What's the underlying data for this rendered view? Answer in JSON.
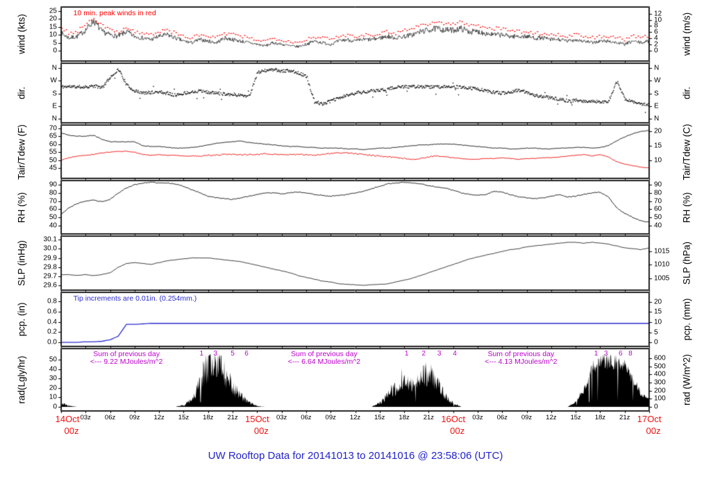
{
  "figure": {
    "title": "UW Rooftop Data for 20141013  to  20141016 @ 23:58:06  (UTC)"
  },
  "colors": {
    "line_black": "#000000",
    "peak_red": "#ff0000",
    "dew_red": "#ee1111",
    "annotation_red": "#ff0000",
    "pcp_blue": "#2a2acc",
    "title_blue": "#2222cc",
    "rad_magenta": "#bb00cc",
    "date_red": "#f01010",
    "axis": "#000000"
  },
  "x_axis": {
    "hours_span": 72,
    "minor_tick_hours": 3,
    "minor_labels": [
      "03z",
      "06z",
      "09z",
      "12z",
      "15z",
      "18z",
      "21z"
    ],
    "major_labels": [
      {
        "day": "14Oct",
        "hour": "00z",
        "t": 0
      },
      {
        "day": "15Oct",
        "hour": "00z",
        "t": 24
      },
      {
        "day": "16Oct",
        "hour": "00z",
        "t": 48
      },
      {
        "day": "17Oct",
        "hour": "00z",
        "t": 72
      }
    ]
  },
  "panels": [
    {
      "id": "wind",
      "label_left": "wind (kts)",
      "label_right": "wind (m/s)",
      "ylim": [
        -6.6,
        27.6
      ],
      "ticks_left": [
        {
          "v": 0,
          "label": "0"
        },
        {
          "v": 5,
          "label": "5"
        },
        {
          "v": 10,
          "label": "10"
        },
        {
          "v": 15,
          "label": "15"
        },
        {
          "v": 20,
          "label": "20"
        },
        {
          "v": 25,
          "label": "25"
        }
      ],
      "ticks_right": [
        {
          "v": 0,
          "label": "0"
        },
        {
          "v": 3.89,
          "label": "2"
        },
        {
          "v": 7.78,
          "label": "4"
        },
        {
          "v": 11.66,
          "label": "6"
        },
        {
          "v": 15.55,
          "label": "8"
        },
        {
          "v": 19.44,
          "label": "10"
        },
        {
          "v": 23.33,
          "label": "12"
        }
      ],
      "annotation": {
        "text": "10 min. peak winds in red",
        "t": 1.5,
        "color_key": "annotation_red"
      }
    },
    {
      "id": "dir",
      "label_left": "dir.",
      "label_right": "dir.",
      "ylim": [
        -29,
        394
      ],
      "ticks_left": [
        {
          "v": 0,
          "label": "N"
        },
        {
          "v": 90,
          "label": "E"
        },
        {
          "v": 180,
          "label": "S"
        },
        {
          "v": 270,
          "label": "W"
        },
        {
          "v": 360,
          "label": "N"
        }
      ],
      "ticks_right": [
        {
          "v": 0,
          "label": "N"
        },
        {
          "v": 90,
          "label": "E"
        },
        {
          "v": 180,
          "label": "S"
        },
        {
          "v": 270,
          "label": "W"
        },
        {
          "v": 360,
          "label": "N"
        }
      ]
    },
    {
      "id": "tair",
      "label_left": "Tair/Tdew (F)",
      "label_right": "Tair/Tdew (C)",
      "ylim": [
        38.5,
        72
      ],
      "ticks_left": [
        {
          "v": 45,
          "label": "45"
        },
        {
          "v": 50,
          "label": "50"
        },
        {
          "v": 55,
          "label": "55"
        },
        {
          "v": 60,
          "label": "60"
        },
        {
          "v": 65,
          "label": "65"
        },
        {
          "v": 70,
          "label": "70"
        }
      ],
      "ticks_right": [
        {
          "v": 50,
          "label": "10"
        },
        {
          "v": 59,
          "label": "15"
        },
        {
          "v": 68,
          "label": "20"
        }
      ]
    },
    {
      "id": "rh",
      "label_left": "RH (%)",
      "label_right": "RH (%)",
      "ylim": [
        29.8,
        95.1
      ],
      "ticks_left": [
        {
          "v": 40,
          "label": "40"
        },
        {
          "v": 50,
          "label": "50"
        },
        {
          "v": 60,
          "label": "60"
        },
        {
          "v": 70,
          "label": "70"
        },
        {
          "v": 80,
          "label": "80"
        },
        {
          "v": 90,
          "label": "90"
        }
      ],
      "ticks_right": [
        {
          "v": 40,
          "label": "40"
        },
        {
          "v": 50,
          "label": "50"
        },
        {
          "v": 60,
          "label": "60"
        },
        {
          "v": 70,
          "label": "70"
        },
        {
          "v": 80,
          "label": "80"
        },
        {
          "v": 90,
          "label": "90"
        }
      ]
    },
    {
      "id": "slp",
      "label_left": "SLP (inHg)",
      "label_right": "SLP (hPa)",
      "ylim": [
        29.551,
        30.137
      ],
      "ticks_left": [
        {
          "v": 29.6,
          "label": "29.6"
        },
        {
          "v": 29.7,
          "label": "29.7"
        },
        {
          "v": 29.8,
          "label": "29.8"
        },
        {
          "v": 29.9,
          "label": "29.9"
        },
        {
          "v": 30.0,
          "label": "30.0"
        },
        {
          "v": 30.1,
          "label": "30.1"
        }
      ],
      "ticks_right": [
        {
          "v": 29.678,
          "label": "1005"
        },
        {
          "v": 29.826,
          "label": "1010"
        },
        {
          "v": 29.973,
          "label": "1015"
        }
      ]
    },
    {
      "id": "pcp",
      "label_left": "pcp. (in)",
      "label_right": "pcp. (mm)",
      "ylim": [
        -0.081,
        0.977
      ],
      "ticks_left": [
        {
          "v": 0,
          "label": "0.0"
        },
        {
          "v": 0.2,
          "label": "0.2"
        },
        {
          "v": 0.4,
          "label": "0.4"
        },
        {
          "v": 0.6,
          "label": "0.6"
        },
        {
          "v": 0.8,
          "label": "0.8"
        }
      ],
      "ticks_right": [
        {
          "v": 0,
          "label": "0"
        },
        {
          "v": 0.197,
          "label": "5"
        },
        {
          "v": 0.394,
          "label": "10"
        },
        {
          "v": 0.591,
          "label": "15"
        },
        {
          "v": 0.787,
          "label": "20"
        }
      ],
      "annotation": {
        "text": "Tip increments are 0.01in. (0.254mm.)",
        "t": 1.5,
        "color_key": "pcp_blue"
      }
    },
    {
      "id": "rad",
      "label_left": "rad(Lgly/hr)",
      "label_right": "rad (W/m^2)",
      "ylim": [
        -4.4,
        61.8
      ],
      "ticks_left": [
        {
          "v": 0,
          "label": "0"
        },
        {
          "v": 10,
          "label": "10"
        },
        {
          "v": 20,
          "label": "20"
        },
        {
          "v": 30,
          "label": "30"
        },
        {
          "v": 40,
          "label": "40"
        },
        {
          "v": 50,
          "label": "50"
        }
      ],
      "ticks_right": [
        {
          "v": 0,
          "label": "0"
        },
        {
          "v": 8.6,
          "label": "100"
        },
        {
          "v": 17.2,
          "label": "200"
        },
        {
          "v": 25.8,
          "label": "300"
        },
        {
          "v": 34.4,
          "label": "400"
        },
        {
          "v": 43.0,
          "label": "500"
        },
        {
          "v": 51.6,
          "label": "600"
        }
      ],
      "sum_annotations": [
        {
          "line1": "Sum of previous day",
          "line2": "<--- 9.22 MJoules/m^2",
          "t": 8
        },
        {
          "line1": "Sum of previous day",
          "line2": "<--- 6.64 MJoules/m^2",
          "t": 32.2
        },
        {
          "line1": "Sum of previous day",
          "line2": "<--- 4.13 MJoules/m^2",
          "t": 56.3
        }
      ],
      "digit_groups": [
        {
          "items": [
            {
              "label": "1",
              "t": 17.2
            },
            {
              "label": "3",
              "t": 18.9
            },
            {
              "label": "5",
              "t": 21.0
            },
            {
              "label": "6",
              "t": 22.7
            }
          ]
        },
        {
          "items": [
            {
              "label": "1",
              "t": 42.3
            },
            {
              "label": "2",
              "t": 44.4
            },
            {
              "label": "3",
              "t": 46.3
            },
            {
              "label": "4",
              "t": 48.2
            }
          ]
        },
        {
          "items": [
            {
              "label": "1",
              "t": 65.5
            },
            {
              "label": "3",
              "t": 66.7
            },
            {
              "label": "6",
              "t": 68.5
            },
            {
              "label": "8",
              "t": 69.7
            }
          ]
        }
      ]
    }
  ],
  "chart_data": {
    "type": "line",
    "x_unit": "hours since 14Oct 00z (UTC), hourly samples t=0..72",
    "x_range": [
      0,
      72
    ],
    "wind_avg_kts": [
      11,
      8,
      9,
      13,
      19,
      12,
      10,
      9,
      12,
      9,
      8,
      7,
      9,
      10,
      8,
      6,
      5,
      7,
      6,
      5,
      8,
      7,
      6,
      5,
      4,
      3,
      5,
      4,
      3,
      2.5,
      4,
      6,
      5,
      4,
      6,
      7,
      6,
      7,
      7,
      8,
      9,
      8,
      9,
      10,
      12,
      13,
      14,
      13,
      13,
      14,
      12,
      12,
      11,
      10,
      10,
      9,
      9,
      9,
      8,
      8,
      7,
      7,
      6,
      7,
      6,
      5,
      6,
      6,
      5,
      4,
      6,
      5,
      6
    ],
    "wind_peak_kts": [
      15,
      11,
      12,
      17,
      21,
      16,
      13,
      12,
      15,
      12,
      11,
      10,
      12,
      13,
      11,
      9,
      8,
      10,
      9,
      8,
      11,
      10,
      9,
      8,
      7,
      6,
      8,
      7,
      6,
      5,
      7,
      9,
      8,
      7,
      9,
      10,
      9,
      10,
      10,
      11,
      12,
      11,
      13,
      14,
      16,
      17,
      18,
      17,
      17,
      18,
      16,
      16,
      15,
      14,
      14,
      13,
      12,
      12,
      11,
      11,
      10,
      10,
      9,
      10,
      9,
      8,
      9,
      9,
      8,
      7,
      9,
      8,
      9
    ],
    "dir_deg": [
      230,
      232,
      228,
      230,
      235,
      225,
      300,
      355,
      240,
      200,
      185,
      190,
      195,
      185,
      170,
      185,
      195,
      200,
      190,
      185,
      180,
      175,
      170,
      165,
      330,
      345,
      350,
      340,
      345,
      330,
      300,
      120,
      110,
      130,
      150,
      170,
      185,
      195,
      200,
      205,
      215,
      225,
      230,
      232,
      230,
      228,
      230,
      232,
      230,
      225,
      220,
      215,
      200,
      190,
      185,
      195,
      205,
      190,
      170,
      160,
      150,
      140,
      130,
      135,
      125,
      130,
      120,
      130,
      270,
      140,
      120,
      110,
      100
    ],
    "tair_f": [
      67,
      65.5,
      65,
      65,
      65.5,
      63,
      61.5,
      61.5,
      61.5,
      61.5,
      59,
      58.5,
      58.5,
      58,
      57.5,
      57.5,
      58,
      58.5,
      59.5,
      60.5,
      61,
      61.5,
      62,
      61,
      60.5,
      60,
      59.5,
      59,
      58.5,
      58.5,
      58,
      58,
      57.5,
      57.5,
      57.5,
      57,
      57,
      56.5,
      57,
      57.5,
      57.5,
      58,
      58.5,
      59,
      59.5,
      59.5,
      60,
      60,
      60,
      59.5,
      59,
      58.5,
      58,
      57.5,
      57.5,
      57,
      57,
      57.5,
      57.5,
      57,
      57,
      57.5,
      57.5,
      58,
      58,
      57.5,
      58,
      59,
      62,
      64.5,
      66.5,
      68,
      68.5
    ],
    "tdew_f": [
      50,
      51.5,
      52.5,
      53,
      53.5,
      54.5,
      55,
      55.5,
      55.5,
      55,
      53.5,
      53,
      53.5,
      53,
      53,
      52.5,
      52.5,
      52.5,
      53,
      53,
      53.5,
      53.5,
      53.5,
      53.5,
      53.5,
      54,
      53.5,
      53.5,
      53.5,
      53.5,
      53.5,
      53,
      53.5,
      54,
      54.5,
      54.5,
      54,
      53.5,
      53,
      52.5,
      52,
      51.5,
      51,
      50.5,
      51,
      52,
      52.5,
      52,
      51.5,
      51,
      50.5,
      50.5,
      51,
      51,
      51.5,
      51,
      50.5,
      51,
      51,
      51.5,
      51.5,
      52,
      52.5,
      53,
      53.5,
      52.5,
      53.5,
      52,
      49,
      47.5,
      46.5,
      45.5,
      45
    ],
    "rh_pct": [
      54,
      62,
      67,
      70,
      71,
      69,
      72,
      80,
      86,
      90,
      92,
      93,
      92,
      92,
      91,
      88,
      84,
      80,
      76,
      74,
      73,
      72,
      74,
      76,
      78,
      80,
      80,
      79,
      80,
      81,
      80,
      78,
      77,
      76,
      77,
      78,
      80,
      82,
      85,
      88,
      91,
      92,
      93,
      92,
      91,
      89,
      87,
      86,
      83,
      80,
      78,
      77,
      78,
      82,
      81,
      78,
      75,
      74,
      73,
      74,
      76,
      78,
      75,
      76,
      78,
      80,
      81,
      75,
      62,
      55,
      50,
      46,
      44
    ],
    "slp_inhg": [
      29.72,
      29.72,
      29.71,
      29.72,
      29.71,
      29.72,
      29.74,
      29.8,
      29.84,
      29.85,
      29.84,
      29.83,
      29.85,
      29.87,
      29.88,
      29.89,
      29.9,
      29.9,
      29.9,
      29.89,
      29.88,
      29.87,
      29.86,
      29.84,
      29.82,
      29.8,
      29.78,
      29.76,
      29.74,
      29.71,
      29.69,
      29.67,
      29.65,
      29.64,
      29.62,
      29.615,
      29.61,
      29.605,
      29.61,
      29.615,
      29.62,
      29.64,
      29.66,
      29.68,
      29.71,
      29.74,
      29.77,
      29.8,
      29.83,
      29.86,
      29.89,
      29.91,
      29.93,
      29.95,
      29.97,
      29.99,
      30.0,
      30.02,
      30.03,
      30.04,
      30.05,
      30.06,
      30.07,
      30.07,
      30.06,
      30.07,
      30.06,
      30.05,
      30.03,
      30.01,
      30.0,
      29.99,
      30.01
    ],
    "pcp_in": [
      0,
      0,
      0,
      0.01,
      0.01,
      0.02,
      0.05,
      0.12,
      0.35,
      0.35,
      0.36,
      0.37,
      0.37,
      0.37,
      0.37,
      0.37,
      0.37,
      0.37,
      0.37,
      0.37,
      0.37,
      0.37,
      0.37,
      0.37,
      0.37,
      0.37,
      0.37,
      0.37,
      0.37,
      0.37,
      0.37,
      0.37,
      0.37,
      0.37,
      0.37,
      0.37,
      0.37,
      0.37,
      0.37,
      0.37,
      0.37,
      0.37,
      0.37,
      0.37,
      0.37,
      0.37,
      0.37,
      0.37,
      0.37,
      0.37,
      0.37,
      0.37,
      0.37,
      0.37,
      0.37,
      0.37,
      0.37,
      0.37,
      0.37,
      0.37,
      0.37,
      0.37,
      0.37,
      0.37,
      0.37,
      0.37,
      0.37,
      0.37,
      0.37,
      0.37,
      0.37,
      0.37,
      0.37
    ],
    "rad_lyhr": [
      4,
      1,
      0,
      0,
      0,
      0,
      0,
      0,
      0,
      0,
      0,
      0,
      0,
      0,
      0,
      2,
      8,
      25,
      45,
      53,
      40,
      22,
      12,
      5,
      1,
      0,
      0,
      0,
      0,
      0,
      0,
      0,
      0,
      0,
      0,
      0,
      0,
      0,
      0,
      4,
      12,
      20,
      26,
      22,
      32,
      36,
      25,
      12,
      3,
      0,
      0,
      0,
      0,
      0,
      0,
      0,
      0,
      0,
      0,
      0,
      0,
      0,
      0,
      5,
      18,
      42,
      49,
      50,
      48,
      44,
      28,
      14,
      8
    ]
  }
}
